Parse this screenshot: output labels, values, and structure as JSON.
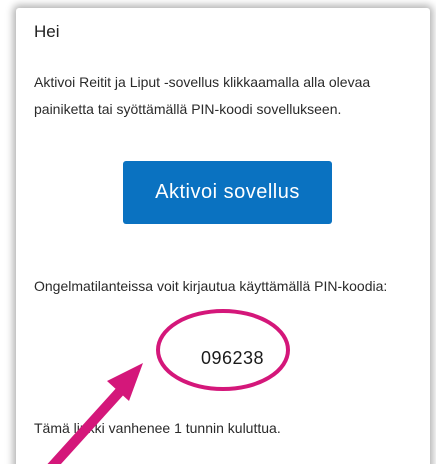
{
  "email": {
    "greeting": "Hei",
    "intro": "Aktivoi Reitit ja Liput -sovellus klikkaamalla alla olevaa painiketta tai syöttämällä PIN-koodi sovellukseen.",
    "button_label": "Aktivoi sovellus",
    "fallback_text": "Ongelmatilanteissa voit kirjautua käyttämällä PIN-koodia:",
    "pin_code": "096238",
    "expiry_text": "Tämä linkki vanhenee 1 tunnin kuluttua."
  },
  "colors": {
    "button": "#0a72c1",
    "annotation": "#d4177a"
  },
  "annotations": {
    "pin_circle": "circle-highlight",
    "pointer": "arrow-icon"
  }
}
